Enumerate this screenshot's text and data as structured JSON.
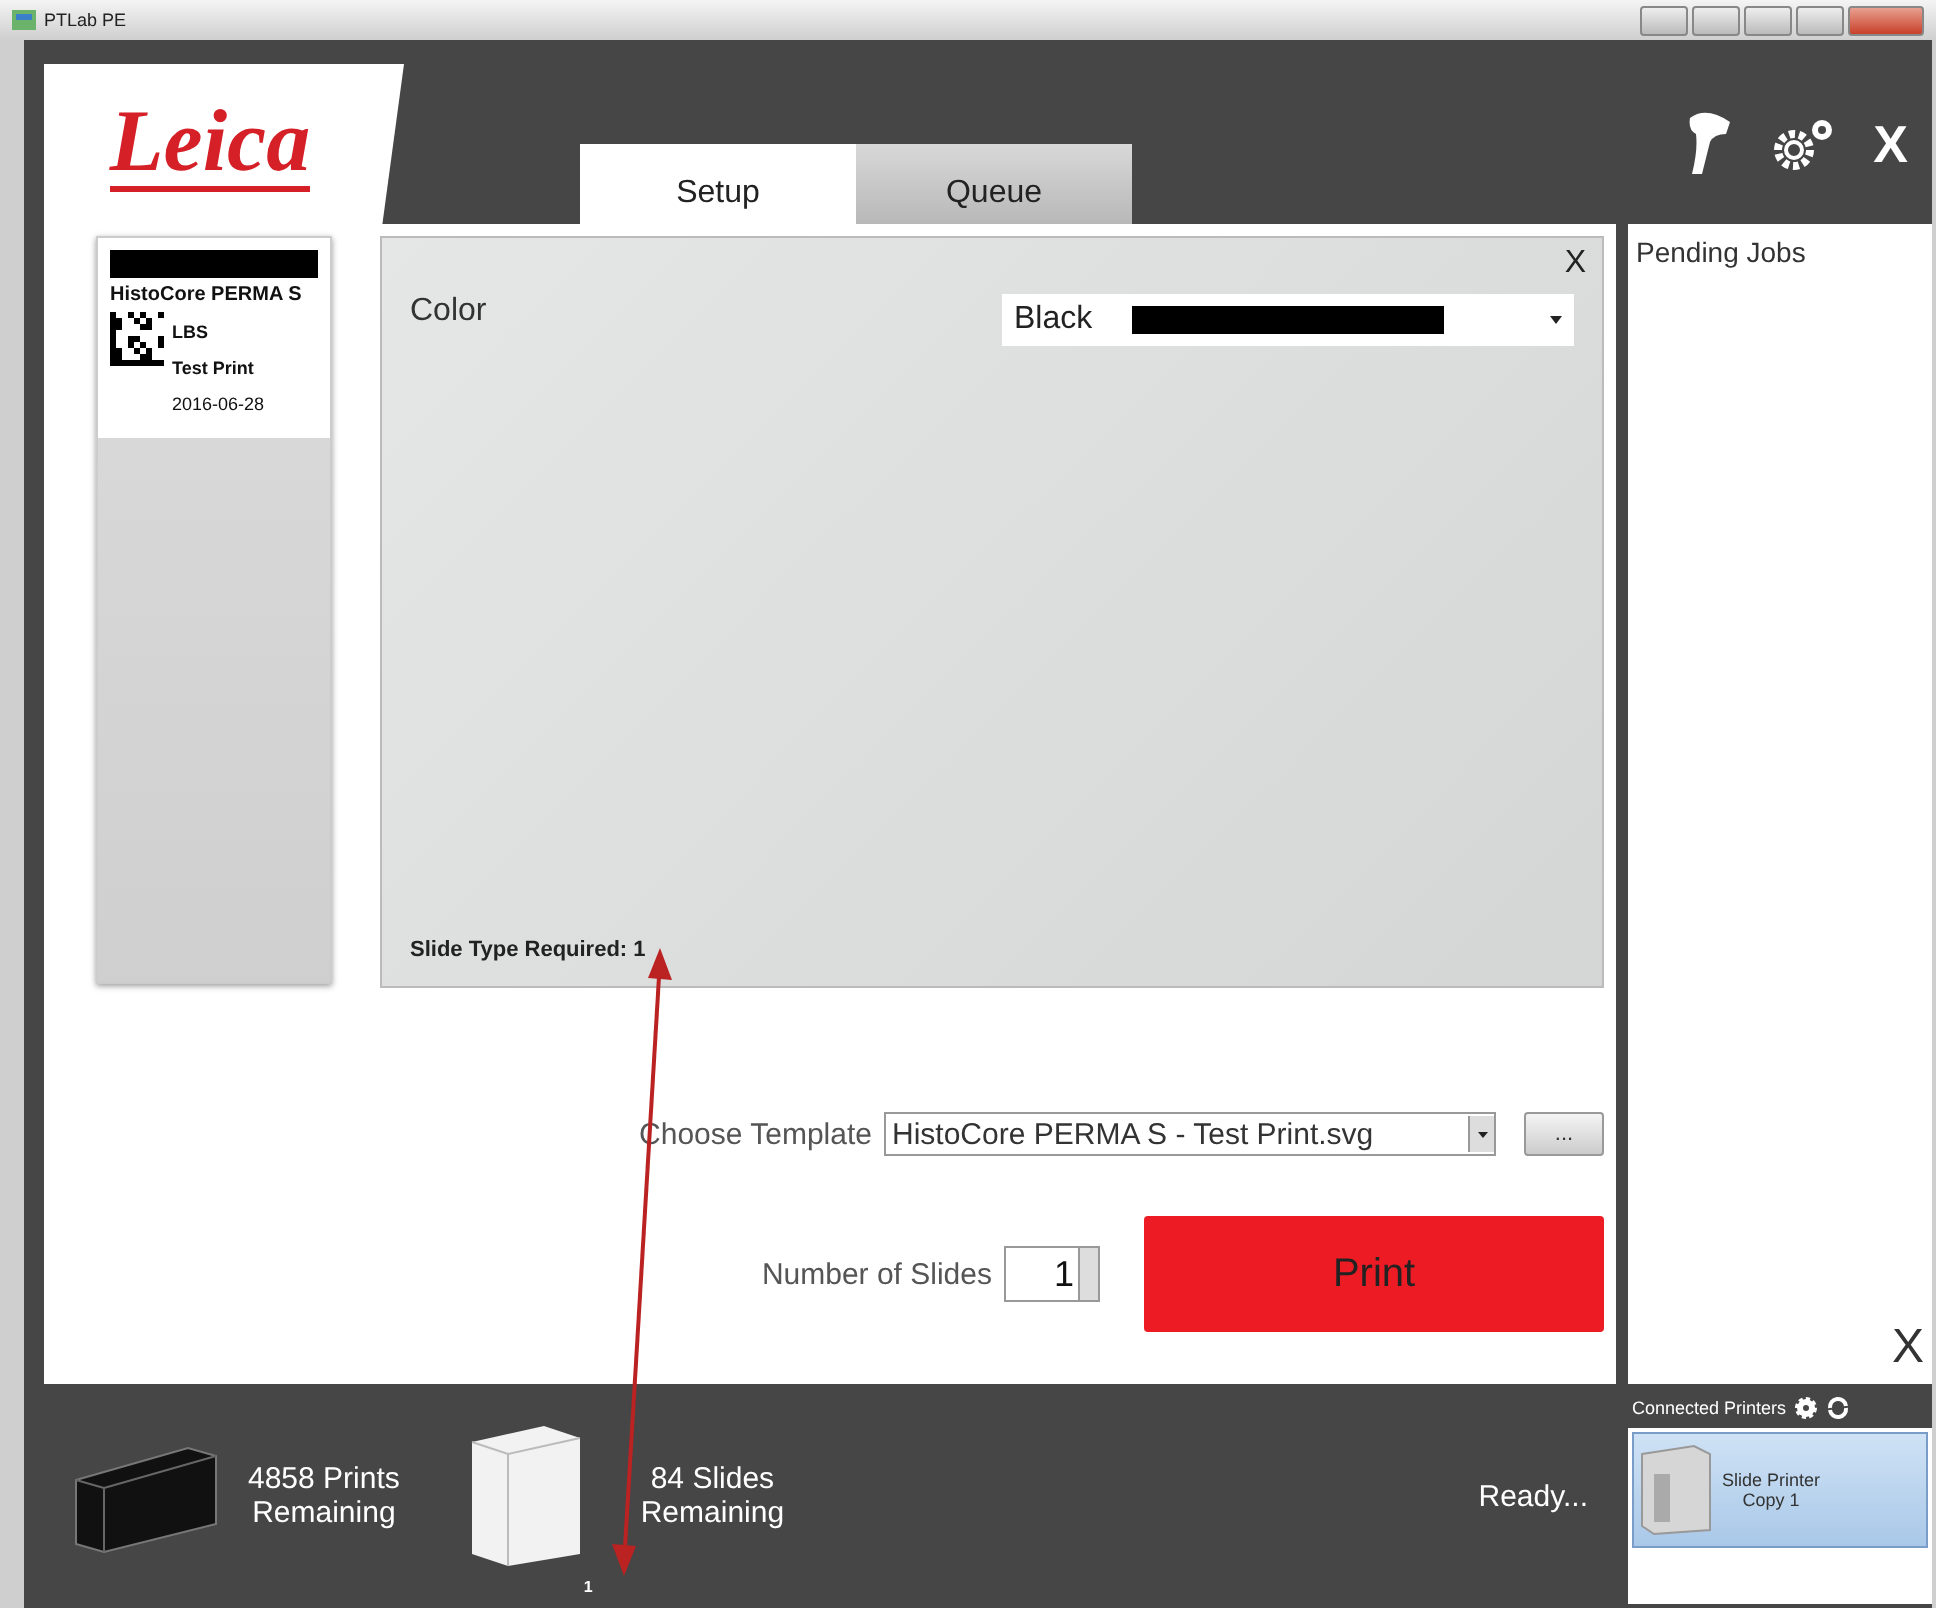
{
  "window": {
    "title": "PTLab PE"
  },
  "header": {
    "logo": "Leica",
    "tabs": [
      {
        "label": "Setup",
        "selected": true
      },
      {
        "label": "Queue",
        "selected": false
      }
    ],
    "close": "X"
  },
  "label_preview": {
    "title": "HistoCore PERMA S",
    "lines": [
      "LBS",
      "Test Print",
      "2016-06-28"
    ]
  },
  "setup_panel": {
    "close": "X",
    "color_label": "Color",
    "color_value": "Black",
    "slide_type": "Slide Type Required: 1"
  },
  "template": {
    "label": "Choose Template",
    "value": "HistoCore PERMA S - Test Print.svg",
    "browse": "..."
  },
  "slides": {
    "label": "Number of Slides",
    "value": "1"
  },
  "print_button": "Print",
  "pending_jobs": {
    "title": "Pending Jobs",
    "clear": "X"
  },
  "status": {
    "prints": [
      "4858 Prints",
      "Remaining"
    ],
    "slides": [
      "84 Slides",
      "Remaining"
    ],
    "stack_count": "1",
    "message": "Ready..."
  },
  "printers": {
    "title": "Connected Printers",
    "items": [
      {
        "name": "Slide Printer",
        "copy": "Copy 1",
        "selected": true
      }
    ]
  }
}
